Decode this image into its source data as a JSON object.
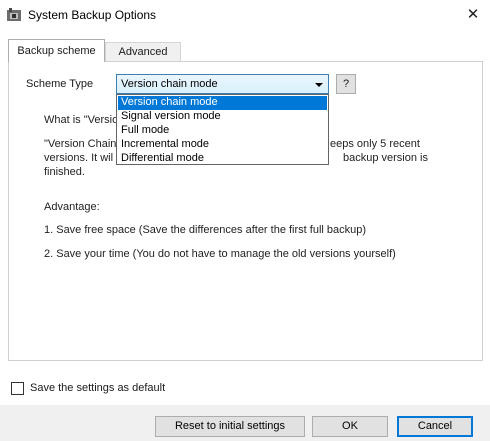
{
  "window": {
    "title": "System Backup Options",
    "close_glyph": "✕",
    "app_icon": "backup-app-icon"
  },
  "tabs": [
    {
      "label": "Backup scheme",
      "active": true
    },
    {
      "label": "Advanced",
      "active": false
    }
  ],
  "scheme": {
    "label": "Scheme Type",
    "selected": "Version chain mode",
    "help_label": "?",
    "options": [
      "Version chain mode",
      "Signal version mode",
      "Full mode",
      "Incremental mode",
      "Differential mode"
    ]
  },
  "description": {
    "what_is_visible": "What is \"Versio",
    "para1_left": "\"Version Chain",
    "para1_right": "eeps only 5 recent",
    "para2_left": "versions. It wil",
    "para2_right": "backup version is",
    "para3": "finished.",
    "advantage_heading": "Advantage:",
    "point1": "1. Save free space (Save the differences after the first full backup)",
    "point2": "2. Save your time (You do not have to manage the old versions yourself)"
  },
  "default_checkbox": {
    "label": "Save the settings as default",
    "checked": false
  },
  "buttons": {
    "reset": "Reset to initial settings",
    "ok": "OK",
    "cancel": "Cancel"
  },
  "colors": {
    "selection": "#0078d7",
    "select_border": "#3c7fb1",
    "footer_bg": "#f0f0f0"
  }
}
